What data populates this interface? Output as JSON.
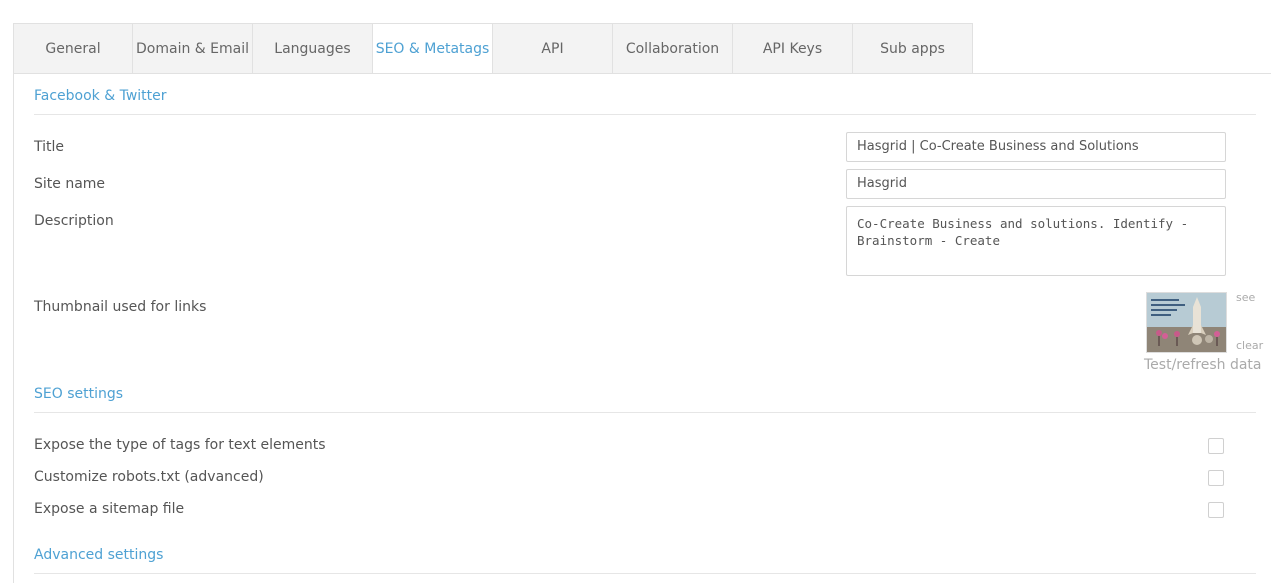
{
  "tabs": [
    {
      "label": "General"
    },
    {
      "label": "Domain & Email"
    },
    {
      "label": "Languages"
    },
    {
      "label": "SEO & Metatags",
      "active": true
    },
    {
      "label": "API"
    },
    {
      "label": "Collaboration"
    },
    {
      "label": "API Keys"
    },
    {
      "label": "Sub apps"
    }
  ],
  "facebook_twitter": {
    "heading": "Facebook & Twitter",
    "title_label": "Title",
    "title_value": "Hasgrid | Co-Create Business and Solutions",
    "site_name_label": "Site name",
    "site_name_value": "Hasgrid",
    "description_label": "Description",
    "description_value": "Co-Create Business and solutions. Identify - Brainstorm - Create",
    "thumbnail_label": "Thumbnail used for links",
    "see_link": "see",
    "clear_link": "clear",
    "test_link": "Test/refresh data"
  },
  "seo_settings": {
    "heading": "SEO settings",
    "options": [
      {
        "label": "Expose the type of tags for text elements",
        "checked": false
      },
      {
        "label": "Customize robots.txt (advanced)",
        "checked": false
      },
      {
        "label": "Expose a sitemap file",
        "checked": false
      }
    ]
  },
  "advanced_settings": {
    "heading": "Advanced settings"
  },
  "colors": {
    "accent": "#4ea1d3",
    "tab_bg": "#f3f3f3",
    "border": "#e1e1e1"
  }
}
